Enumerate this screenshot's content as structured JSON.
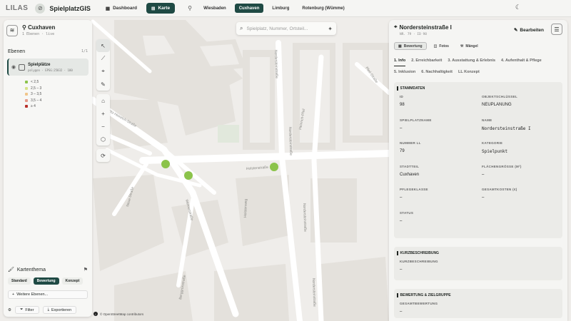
{
  "topbar": {
    "logo": "LILAS",
    "app_title": "SpielplatzGIS",
    "dashboard_label": "Dashboard",
    "map_label": "Karte",
    "cities": [
      "Wiesbaden",
      "Cuxhaven",
      "Limburg",
      "Rotenburg (Wümme)"
    ],
    "active_city": "Cuxhaven"
  },
  "left_panel": {
    "title": "Cuxhaven",
    "subtitle": "1 Ebenen · live",
    "layers_heading": "Ebenen",
    "layers_count": "1/1",
    "layer": {
      "name": "Spielplätze",
      "meta": "polygon · EPSG:25832 · 180"
    },
    "legend": [
      {
        "label": "< 2,5",
        "color": "#8bc34a"
      },
      {
        "label": "2,5 – 3",
        "color": "#d7e38a"
      },
      {
        "label": "3 – 3,5",
        "color": "#f0c58a"
      },
      {
        "label": "3,5 – 4",
        "color": "#e59a8a"
      },
      {
        "label": "≥ 4",
        "color": "#b8302b"
      }
    ],
    "theme_heading": "Kartenthema",
    "theme_tabs": [
      "Standard",
      "Bewertung",
      "Konzept"
    ],
    "active_theme": "Bewertung",
    "more_layers": "Weitere Ebenen...",
    "filter_label": "Filter",
    "export_label": "Exportieren"
  },
  "search": {
    "placeholder": "Spielplatz, Nummer, Ortsteil..."
  },
  "map": {
    "attribution": "© OpenStreetMap contributors",
    "streets": [
      "Fritz-Heinrich-Straße",
      "Holstenstraße",
      "Neue-Straße",
      "Nordersteinstraße",
      "Heinrich-Pfeil",
      "Berggrünstraße",
      "Nordersteinstraße",
      "Wernerstraße",
      "Pfeil-Straße",
      "Holstenweg",
      "Nordersteinstraße",
      "Nordersteinstraße"
    ]
  },
  "right_panel": {
    "title": "Nordersteinstraße I",
    "sub": "NR. 79 · ID 98",
    "edit_label": "Bearbeiten",
    "tabs": [
      "Bewertung",
      "Fotos",
      "Mängel"
    ],
    "active_tab": "Bewertung",
    "section_tabs": [
      "1. Info",
      "2. Erreichbarkeit",
      "3. Ausstattung & Erlebnis",
      "4. Aufenthalt & Pflege",
      "5. Inklusion",
      "6. Nachhaltigkeit",
      "LL Konzept"
    ],
    "active_section": "1. Info",
    "stammdaten": {
      "heading": "STAMMDATEN",
      "fields": [
        {
          "label": "ID",
          "value": "98",
          "mono": false
        },
        {
          "label": "OBJEKTSCHLÜSSEL",
          "value": "NEUPLANUNG",
          "mono": false
        },
        {
          "label": "SPIELPLATZNAME",
          "value": "–",
          "mono": false
        },
        {
          "label": "NAME",
          "value": "Nordersteinstraße I",
          "mono": true
        },
        {
          "label": "NUMMER LL",
          "value": "79",
          "mono": false
        },
        {
          "label": "KATEGORIE",
          "value": "Spielpunkt",
          "mono": true
        },
        {
          "label": "STADTTEIL",
          "value": "Cuxhaven",
          "mono": false
        },
        {
          "label": "FLÄCHENGRÖSSE (M²)",
          "value": "–",
          "mono": false
        },
        {
          "label": "PFLEGEKLASSE",
          "value": "–",
          "mono": false
        },
        {
          "label": "GESAMTKOSTEN (€)",
          "value": "–",
          "mono": false
        },
        {
          "label": "STATUS",
          "value": "–",
          "mono": false
        }
      ]
    },
    "kurzbeschreibung": {
      "heading": "KURZBESCHREIBUNG",
      "label": "KURZBESCHREIBUNG",
      "value": "–"
    },
    "bewertung": {
      "heading": "BEWERTUNG & ZIELGRUPPE",
      "label": "GESAMTBEWERTUNG",
      "value": "–"
    }
  }
}
